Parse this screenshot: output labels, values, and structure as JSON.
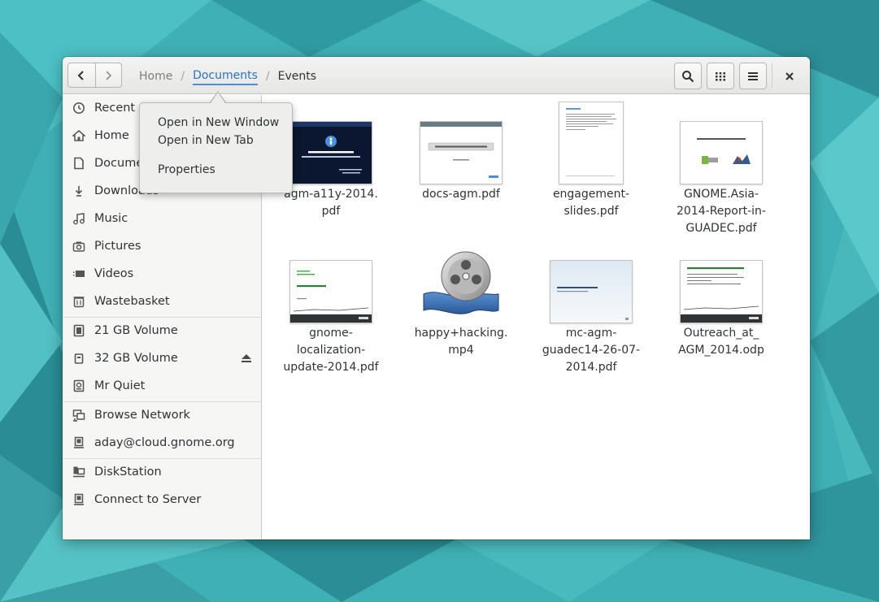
{
  "window": {
    "breadcrumb": [
      "Home",
      "Documents",
      "Events"
    ],
    "back_icon": "go-back-icon",
    "forward_icon": "go-forward-icon",
    "search_icon": "search-icon",
    "view_icon": "grid-view-icon",
    "menu_icon": "hamburger-menu-icon",
    "close_icon": "close-icon"
  },
  "sidebar": {
    "places": [
      {
        "label": "Recent",
        "icon": "clock-icon"
      },
      {
        "label": "Home",
        "icon": "home-icon"
      },
      {
        "label": "Documents",
        "icon": "document-icon"
      },
      {
        "label": "Downloads",
        "icon": "download-icon"
      },
      {
        "label": "Music",
        "icon": "music-icon"
      },
      {
        "label": "Pictures",
        "icon": "camera-icon"
      },
      {
        "label": "Videos",
        "icon": "video-icon"
      },
      {
        "label": "Wastebasket",
        "icon": "trash-icon"
      }
    ],
    "devices": [
      {
        "label": "21 GB Volume",
        "icon": "drive-icon"
      },
      {
        "label": "32 GB Volume",
        "icon": "usb-drive-icon",
        "eject": "eject-icon"
      },
      {
        "label": "Mr Quiet",
        "icon": "drive-icon"
      }
    ],
    "network": [
      {
        "label": "Browse Network",
        "icon": "network-icon"
      },
      {
        "label": "aday@cloud.gnome.org",
        "icon": "server-icon"
      }
    ],
    "bookmarks": [
      {
        "label": "DiskStation",
        "icon": "network-server-icon"
      },
      {
        "label": "Connect to Server",
        "icon": "server-icon"
      }
    ]
  },
  "files": [
    {
      "name_lines": [
        "agm-a11y-2014.",
        "pdf"
      ],
      "type": "pdf"
    },
    {
      "name_lines": [
        "docs-agm.pdf"
      ],
      "type": "pdf"
    },
    {
      "name_lines": [
        "engagement-",
        "slides.pdf"
      ],
      "type": "pdf"
    },
    {
      "name_lines": [
        "GNOME.Asia-",
        "2014-Report-in-",
        "GUADEC.pdf"
      ],
      "type": "pdf"
    },
    {
      "name_lines": [
        "gnome-",
        "localization-",
        "update-2014.pdf"
      ],
      "type": "pdf"
    },
    {
      "name_lines": [
        "happy+hacking.",
        "mp4"
      ],
      "type": "video"
    },
    {
      "name_lines": [
        "mc-agm-",
        "guadec14-26-07-",
        "2014.pdf"
      ],
      "type": "pdf"
    },
    {
      "name_lines": [
        "Outreach_at_",
        "AGM_2014.odp"
      ],
      "type": "presentation"
    }
  ],
  "context_menu": {
    "items": [
      "Open in New Window",
      "Open in New Tab",
      "Properties"
    ]
  },
  "colors": {
    "accent": "#4a90d9",
    "wallpaper": "#3aaab0"
  }
}
